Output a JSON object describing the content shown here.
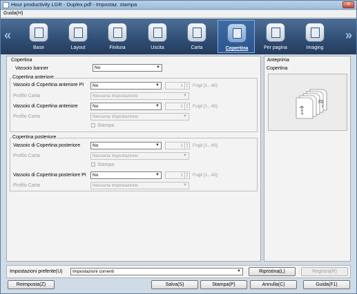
{
  "window": {
    "title": "Hour productivity LGR - Duplex.pdf - Impostaz. stampa",
    "close_symbol": "✕"
  },
  "menu": {
    "help": "Guida(H)"
  },
  "toolbar": {
    "tabs": [
      {
        "label": "Base",
        "icon": "base-icon"
      },
      {
        "label": "Layout",
        "icon": "layout-icon"
      },
      {
        "label": "Finitura",
        "icon": "finishing-icon"
      },
      {
        "label": "Uscita",
        "icon": "output-icon"
      },
      {
        "label": "Carta",
        "icon": "paper-icon"
      },
      {
        "label": "Copertina",
        "icon": "cover-icon",
        "active": true
      },
      {
        "label": "Per pagina",
        "icon": "per-page-icon"
      },
      {
        "label": "Imaging",
        "icon": "imaging-icon"
      }
    ],
    "prev_symbol": "«",
    "next_symbol": "»"
  },
  "cover": {
    "title": "Copertina",
    "banner_tray_label": "Vassoio banner",
    "banner_tray_value": "No",
    "front": {
      "title": "Copertina anteriore",
      "pi_tray_label": "Vassoio di Copertina anteriore PI",
      "pi_tray_value": "No",
      "pi_sheets": "1",
      "pi_sheets_range": "Fogli [1...40]",
      "pi_profile_label": "Profilo Carta",
      "pi_profile_value": "Nessuna impostazione",
      "tray_label": "Vassoio di Copertina anteriore",
      "tray_value": "No",
      "sheets": "1",
      "sheets_range": "Fogli [1...40]",
      "profile_label": "Profilo Carta",
      "profile_value": "Nessuna impostazione",
      "print_label": "Stampa"
    },
    "back": {
      "title": "Copertina posteriore",
      "tray_label": "Vassoio di Copertina posteriore",
      "tray_value": "No",
      "sheets": "1",
      "sheets_range": "Fogli [1...40]",
      "profile_label": "Profilo Carta",
      "profile_value": "Nessuna impostazione",
      "print_label": "Stampa",
      "pi_tray_label": "Vassoio di Copertina posteriore PI",
      "pi_tray_value": "No",
      "pi_sheets": "1",
      "pi_sheets_range": "Fogli [1...40]",
      "pi_profile_label": "Profilo Carta",
      "pi_profile_value": "Nessuna impostazione"
    }
  },
  "preview": {
    "title": "Anteprima",
    "subtitle": "Copertina",
    "page_labels": [
      "1",
      "n",
      "1"
    ]
  },
  "favorites": {
    "label": "Impostazioni preferite(U)",
    "value": "Impostazioni correnti",
    "restore_label": "Ripristina(L)",
    "register_label": "Registra(R)"
  },
  "buttons": {
    "reset": "Reimposta(Z)",
    "save": "Salva(S)",
    "print": "Stampa(P)",
    "cancel": "Annulla(C)",
    "help": "Guida(F1)"
  }
}
